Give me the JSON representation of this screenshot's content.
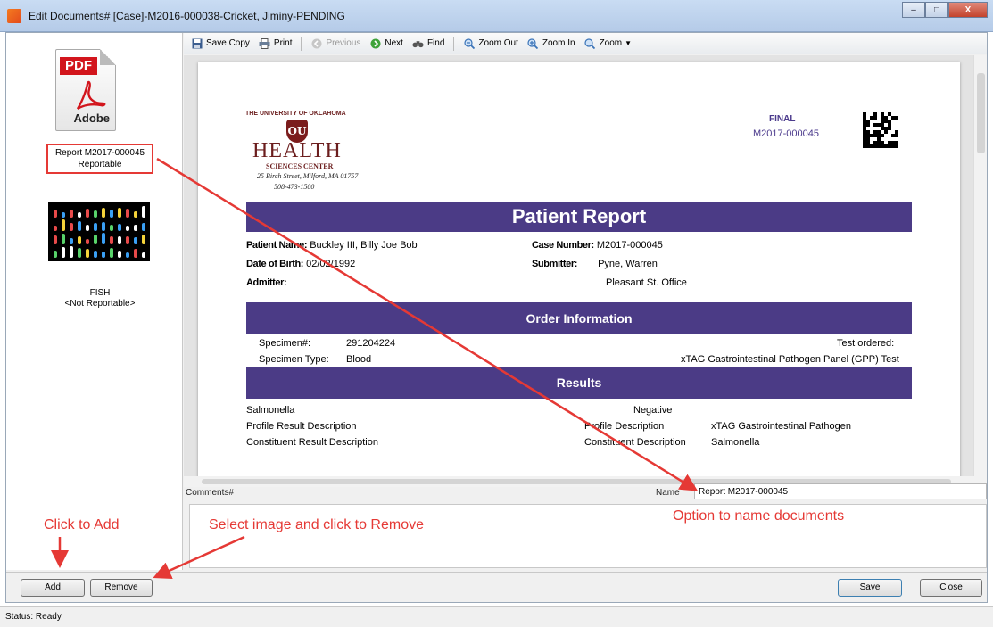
{
  "window": {
    "title": "Edit Documents# [Case]-M2016-000038-Cricket, Jiminy-PENDING",
    "controls": {
      "minimize": "–",
      "maximize": "□",
      "close": "X"
    }
  },
  "left_panel": {
    "documents": [
      {
        "thumb_type": "pdf",
        "thumb_banner": "PDF",
        "thumb_brand": "Adobe",
        "name": "Report M2017-000045",
        "status": "Reportable",
        "selected": true
      },
      {
        "thumb_type": "fish-image",
        "name": "FISH",
        "status": "<Not Reportable>",
        "selected": false
      }
    ]
  },
  "toolbar": {
    "save_copy": "Save Copy",
    "print": "Print",
    "previous": "Previous",
    "next": "Next",
    "find": "Find",
    "zoom_out": "Zoom Out",
    "zoom_in": "Zoom In",
    "zoom": "Zoom"
  },
  "report": {
    "logo": {
      "university": "THE UNIVERSITY OF OKLAHOMA",
      "health": "HEALTH",
      "sciences": "SCIENCES CENTER",
      "address": "25 Birch Street, Milford, MA 01757",
      "phone": "508-473-1500"
    },
    "status": "FINAL",
    "case_number_header": "M2017-000045",
    "title": "Patient Report",
    "patient_name_label": "Patient Name:",
    "patient_name": "Buckley III, Billy Joe Bob",
    "dob_label": "Date of Birth:",
    "dob": "02/02/1992",
    "admitter_label": "Admitter:",
    "case_number_label": "Case Number:",
    "case_number": "M2017-000045",
    "submitter_label": "Submitter:",
    "submitter": "Pyne, Warren",
    "submitter_office": "Pleasant St. Office",
    "order_info_title": "Order Information",
    "specimen_num_label": "Specimen#:",
    "specimen_num": "291204224",
    "test_ordered_label": "Test ordered:",
    "specimen_type_label": "Specimen Type:",
    "specimen_type": "Blood",
    "test_ordered": "xTAG Gastrointestinal Pathogen Panel (GPP) Test",
    "results_title": "Results",
    "result_name": "Salmonella",
    "result_value": "Negative",
    "profile_result_desc_label": "Profile Result Description",
    "profile_desc_label": "Profile Description",
    "profile_desc": "xTAG Gastrointestinal Pathogen",
    "constituent_result_desc_label": "Constituent Result Description",
    "constituent_desc_label": "Constituent Description",
    "constituent_desc": "Salmonella"
  },
  "form": {
    "comments_label": "Comments#",
    "name_label": "Name",
    "name_value": "Report M2017-000045"
  },
  "buttons": {
    "add": "Add",
    "remove": "Remove",
    "save": "Save",
    "close": "Close"
  },
  "status": "Status: Ready",
  "annotations": {
    "click_to_add": "Click to Add",
    "select_remove": "Select image and click to Remove",
    "name_docs": "Option to name documents"
  },
  "colors": {
    "accent": "#4b3b86",
    "annotation": "#e53935",
    "pdf_red": "#d2151c",
    "ou_crimson": "#7b1c1c"
  }
}
